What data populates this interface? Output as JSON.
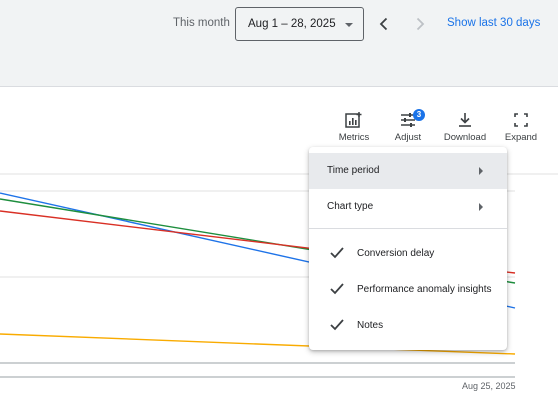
{
  "header": {
    "month_label": "This month",
    "date_range": "Aug 1 – 28, 2025",
    "show_last_label": "Show last 30 days",
    "prev_icon": "chevron-left-icon",
    "next_icon": "chevron-right-icon"
  },
  "toolbar": {
    "metrics_label": "Metrics",
    "adjust_label": "Adjust",
    "adjust_badge": "3",
    "download_label": "Download",
    "expand_label": "Expand"
  },
  "chart": {
    "x_label": "Aug 25, 2025"
  },
  "chart_data": {
    "type": "line",
    "x_tick_labels": [
      "Aug 25, 2025"
    ],
    "series": [
      {
        "color": "#1e73e8",
        "trend": "declining"
      },
      {
        "color": "#1e8e3e",
        "trend": "declining"
      },
      {
        "color": "#d93025",
        "trend": "declining"
      },
      {
        "color": "#f9ab00",
        "trend": "slightly declining"
      }
    ],
    "grid": true
  },
  "menu": {
    "items": [
      {
        "label": "Time period",
        "submenu": true,
        "checked": false,
        "hover": true
      },
      {
        "label": "Chart type",
        "submenu": true,
        "checked": false,
        "hover": false
      },
      {
        "label": "Conversion delay",
        "submenu": false,
        "checked": true,
        "hover": false
      },
      {
        "label": "Performance anomaly insights",
        "submenu": false,
        "checked": true,
        "hover": false
      },
      {
        "label": "Notes",
        "submenu": false,
        "checked": true,
        "hover": false
      }
    ]
  },
  "colors": {
    "accent": "#1a73e8",
    "series_blue": "#1e73e8",
    "series_green": "#1e8e3e",
    "series_red": "#d93025",
    "series_yellow": "#f9ab00"
  }
}
